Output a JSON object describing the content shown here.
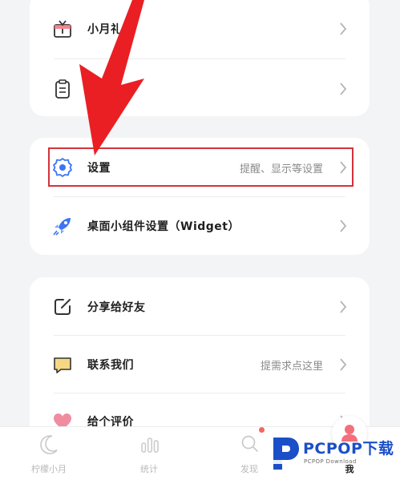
{
  "colors": {
    "accent": "#3d74f0",
    "highlight": "#d1343c",
    "arrow": "#ea1f24",
    "tab_inactive": "#b9b9b9",
    "badge": "#f0675f",
    "avatar": "#f2707a"
  },
  "cards": [
    {
      "rows": [
        {
          "icon": "gift-calendar-icon",
          "label": "小月礼包",
          "hint": ""
        },
        {
          "icon": "clipboard-icon",
          "label": "",
          "hint": ""
        }
      ]
    },
    {
      "rows": [
        {
          "icon": "gear-icon",
          "label": "设置",
          "hint": "提醒、显示等设置"
        },
        {
          "icon": "rocket-icon",
          "label": "桌面小组件设置（Widget）",
          "hint": ""
        }
      ]
    },
    {
      "rows": [
        {
          "icon": "share-edit-icon",
          "label": "分享给好友",
          "hint": ""
        },
        {
          "icon": "chat-bubble-icon",
          "label": "联系我们",
          "hint": "提需求点这里"
        },
        {
          "icon": "heart-icon",
          "label": "给个评价",
          "hint": ""
        }
      ]
    }
  ],
  "tabbar": {
    "tabs": [
      {
        "icon": "moon-icon",
        "label": "柠檬小月"
      },
      {
        "icon": "bar-chart-icon",
        "label": "统计"
      },
      {
        "icon": "search-icon",
        "label": "发现"
      },
      {
        "icon": "user-avatar-icon",
        "label": "我"
      }
    ]
  },
  "watermark": {
    "brand": "PCPOP下载",
    "sub": "PCPOP Download"
  }
}
